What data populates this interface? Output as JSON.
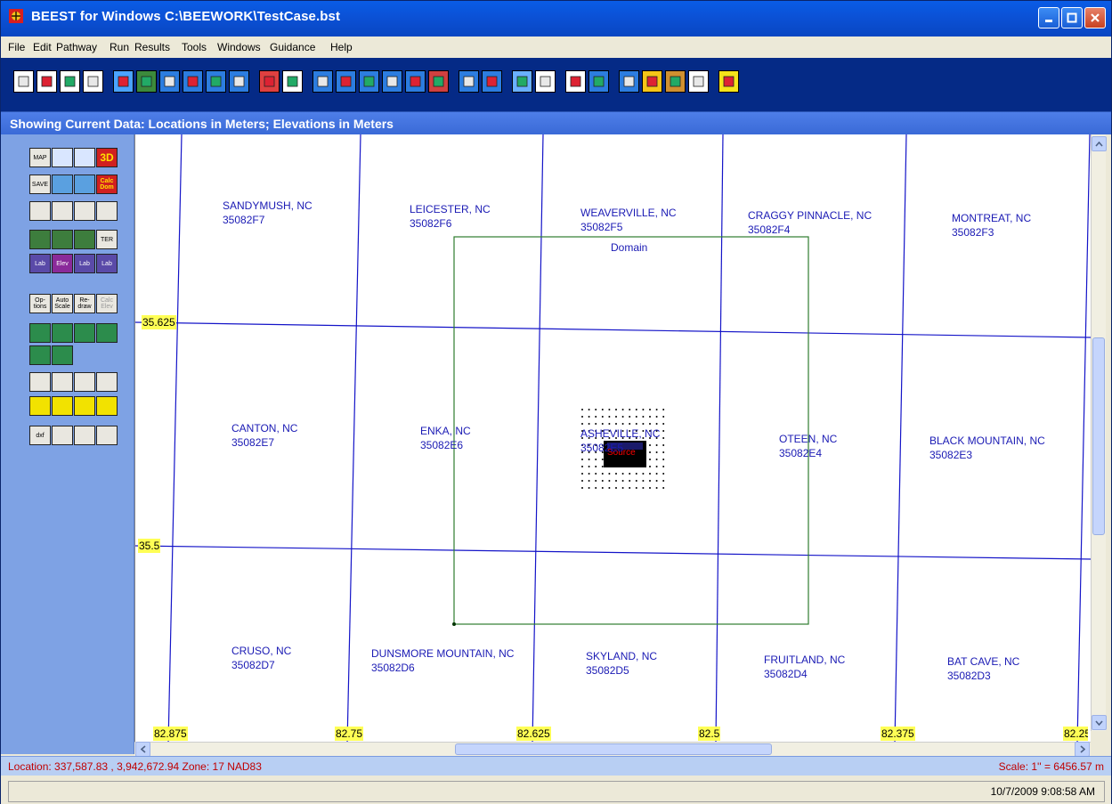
{
  "window": {
    "title": "BEEST for Windows   C:\\BEEWORK\\TestCase.bst"
  },
  "menu": {
    "items": [
      "File",
      "Edit",
      "Pathway",
      "Run",
      "Results",
      "Tools",
      "Windows",
      "Guidance",
      "Help"
    ]
  },
  "toolbar": {
    "icons": [
      "new-file-icon",
      "open-folder-icon",
      "save-icon",
      "print-icon",
      "cond-rural-icon",
      "terrain-icon",
      "points-icon",
      "contour-icon",
      "elevation-icon",
      "label-icon",
      "run-icon",
      "grid-icon",
      "bpip-prime-icon",
      "aermet-icon",
      "aermap-icon",
      "baermap-icon",
      "aer-icon",
      "globe-icon",
      "import-icon",
      "prime-icon",
      "view-icon",
      "plot-out-icon",
      "ex-icon",
      "map-icon",
      "calc-icon",
      "clock-icon",
      "bars-icon",
      "graph-icon",
      "help-icon"
    ]
  },
  "infobar": {
    "text": "Showing Current Data:  Locations in Meters; Elevations in Meters"
  },
  "palette": {
    "rows": [
      [
        {
          "label": "MAP",
          "icon": "map-label-icon"
        },
        {
          "label": "",
          "icon": "print-map-icon"
        },
        {
          "label": "",
          "icon": "save-map-icon"
        },
        {
          "label": "3D",
          "icon": "3d-icon"
        }
      ],
      [
        {
          "label": "SAVE",
          "icon": "save-image-icon"
        },
        {
          "label": "",
          "icon": "grid-icon"
        },
        {
          "label": "",
          "icon": "target-grid-icon"
        },
        {
          "label": "Calc Dom",
          "icon": "calc-domain-icon"
        }
      ],
      [
        {
          "label": "",
          "icon": "zoom-in-icon"
        },
        {
          "label": "",
          "icon": "zoom-out-icon"
        },
        {
          "label": "",
          "icon": "zoom-reset-icon"
        },
        {
          "label": "",
          "icon": "pan-hand-icon"
        }
      ],
      [
        {
          "label": "",
          "icon": "terrain-icon"
        },
        {
          "label": "",
          "icon": "points-icon"
        },
        {
          "label": "",
          "icon": "label-box-icon"
        },
        {
          "label": "TER",
          "icon": "ter-icon"
        }
      ],
      [
        {
          "label": "Lab",
          "icon": "lab-terrain-icon"
        },
        {
          "label": "Elev",
          "icon": "elev-icon"
        },
        {
          "label": "Lab",
          "icon": "lab-box-icon"
        },
        {
          "label": "Lab",
          "icon": "lab-ter-icon"
        }
      ],
      [
        {
          "label": "Op- tions",
          "icon": "options-icon"
        },
        {
          "label": "Auto Scale",
          "icon": "autoscale-icon"
        },
        {
          "label": "Re- draw",
          "icon": "redraw-icon"
        },
        {
          "label": "Calc Elev",
          "icon": "calc-elev-icon"
        }
      ],
      [
        {
          "label": "",
          "icon": "source-icon"
        },
        {
          "label": "",
          "icon": "building-icon"
        },
        {
          "label": "",
          "icon": "building2-icon"
        },
        {
          "label": "",
          "icon": "building3-icon"
        }
      ],
      [
        {
          "label": "",
          "icon": "area-source-icon"
        },
        {
          "label": "",
          "icon": "road-icon"
        }
      ],
      [
        {
          "label": "",
          "icon": "receptor-grid-icon"
        },
        {
          "label": "",
          "icon": "polar-grid-icon"
        },
        {
          "label": "",
          "icon": "discrete-points-icon"
        },
        {
          "label": "",
          "icon": "fence-icon"
        }
      ],
      [
        {
          "label": "",
          "icon": "area-icon"
        },
        {
          "label": "",
          "icon": "volume-icon"
        },
        {
          "label": "",
          "icon": "tank-icon"
        },
        {
          "label": "",
          "icon": "line-icon"
        }
      ],
      [
        {
          "label": "dxf",
          "icon": "dxf-icon"
        },
        {
          "label": "",
          "icon": "copy-icon"
        },
        {
          "label": "",
          "icon": "delete-icon"
        },
        {
          "label": "",
          "icon": "window-icon"
        }
      ]
    ]
  },
  "map": {
    "domain_label": "Domain",
    "quads": [
      {
        "name": "SANDYMUSH, NC",
        "code": "35082F7"
      },
      {
        "name": "LEICESTER, NC",
        "code": "35082F6"
      },
      {
        "name": "WEAVERVILLE, NC",
        "code": "35082F5"
      },
      {
        "name": "CRAGGY PINNACLE, NC",
        "code": "35082F4"
      },
      {
        "name": "MONTREAT, NC",
        "code": "35082F3"
      },
      {
        "name": "CANTON, NC",
        "code": "35082E7"
      },
      {
        "name": "ENKA, NC",
        "code": "35082E6"
      },
      {
        "name": "ASHEVILLE, NC",
        "code": "35082E5"
      },
      {
        "name": "OTEEN, NC",
        "code": "35082E4"
      },
      {
        "name": "BLACK MOUNTAIN, NC",
        "code": "35082E3"
      },
      {
        "name": "CRUSO, NC",
        "code": "35082D7"
      },
      {
        "name": "DUNSMORE MOUNTAIN, NC",
        "code": "35082D6"
      },
      {
        "name": "SKYLAND, NC",
        "code": "35082D5"
      },
      {
        "name": "FRUITLAND, NC",
        "code": "35082D4"
      },
      {
        "name": "BAT CAVE, NC",
        "code": "35082D3"
      }
    ],
    "lat_labels": [
      "35.625",
      "35.5"
    ],
    "lon_labels": [
      "82.875",
      "82.75",
      "82.625",
      "82.5",
      "82.375",
      "82.25"
    ],
    "gridline_color": "#1414c8",
    "domain_color": "#2e7d2e",
    "label_bg": "#ffff55"
  },
  "status": {
    "location": "Location: 337,587.83 , 3,942,672.94 Zone: 17  NAD83",
    "scale": "Scale: 1'' = 6456.57 m",
    "datetime": "10/7/2009  9:08:58 AM"
  }
}
